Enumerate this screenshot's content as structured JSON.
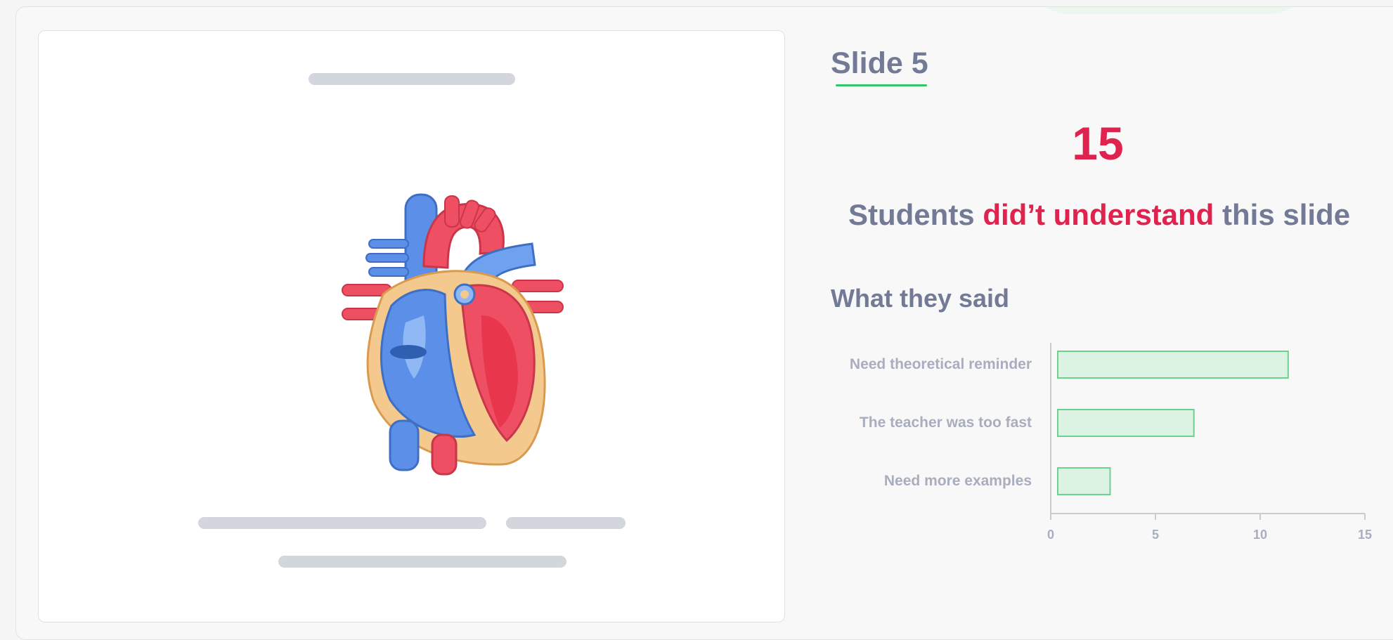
{
  "slide": {
    "title": "Slide 5",
    "image_icon": "heart-anatomy-illustration"
  },
  "summary": {
    "count": "15",
    "text_before": "Students ",
    "text_highlight": "did’t understand",
    "text_after": " this slide"
  },
  "feedback": {
    "section_title": "What they said"
  },
  "colors": {
    "accent_green": "#34c46a",
    "alert_red": "#e0234e",
    "text_slate": "#737a96",
    "bar_fill": "#dcf2e2",
    "bar_stroke": "#6ed08f"
  },
  "chart_data": {
    "type": "bar",
    "orientation": "horizontal",
    "categories": [
      "Need theoretical reminder",
      "The teacher was too fast",
      "Need more examples"
    ],
    "values": [
      11,
      6.5,
      2.5
    ],
    "xticks": [
      0,
      5,
      10,
      15
    ],
    "xlim": [
      0,
      15
    ],
    "grid": false
  }
}
